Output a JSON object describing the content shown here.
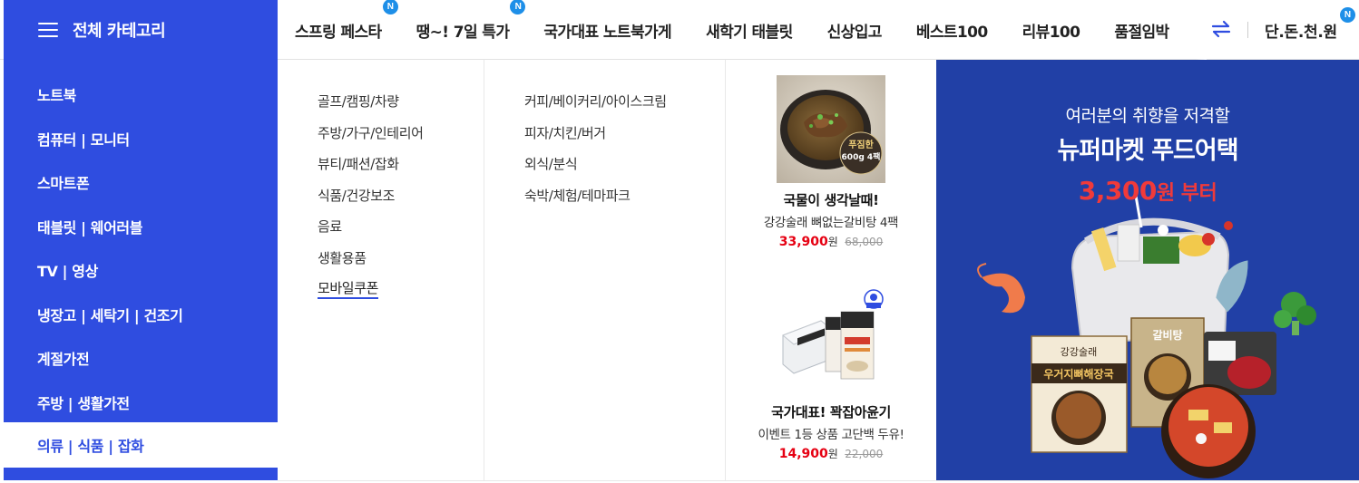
{
  "header": {
    "all_category_label": "전체 카테고리",
    "nav_items": [
      {
        "label": "스프링 페스타",
        "badge": "N"
      },
      {
        "label": "땡~! 7일 특가",
        "badge": "N"
      },
      {
        "label": "국가대표 노트북가게",
        "badge": ""
      },
      {
        "label": "새학기 태블릿",
        "badge": ""
      },
      {
        "label": "신상입고",
        "badge": ""
      },
      {
        "label": "베스트100",
        "badge": ""
      },
      {
        "label": "리뷰100",
        "badge": ""
      },
      {
        "label": "품절임박",
        "badge": ""
      }
    ],
    "right_item": {
      "label": "단.돈.천.원",
      "badge": "N"
    }
  },
  "sidebar": {
    "items": [
      {
        "label": "노트북"
      },
      {
        "label": "컴퓨터 | 모니터"
      },
      {
        "label": "스마트폰"
      },
      {
        "label": "태블릿 | 웨어러블"
      },
      {
        "label": "TV | 영상"
      },
      {
        "label": "냉장고 | 세탁기 | 건조기"
      },
      {
        "label": "계절가전"
      },
      {
        "label": "주방 | 생활가전"
      }
    ],
    "active_item": {
      "label": "의류 | 식품 | 잡화"
    }
  },
  "submenu": {
    "column1": [
      "골프/캠핑/차량",
      "주방/가구/인테리어",
      "뷰티/패션/잡화",
      "식품/건강보조",
      "음료",
      "생활용품",
      "모바일쿠폰"
    ],
    "column1_active": "모바일쿠폰",
    "column2": [
      "커피/베이커리/아이스크림",
      "피자/치킨/버거",
      "외식/분식",
      "숙박/체험/테마파크"
    ]
  },
  "products": [
    {
      "title": "국물이 생각날때!",
      "desc": "강강술래 뼈없는갈비탕 4팩",
      "price": "33,900",
      "won": "원",
      "old_price": "68,000",
      "image_tag_line1": "푸짐한",
      "image_tag_line2": "600g 4팩"
    },
    {
      "title": "국가대표! 꽉잡아윤기",
      "desc": "이벤트 1등 상품 고단백 두유!",
      "price": "14,900",
      "won": "원",
      "old_price": "22,000"
    }
  ],
  "banner": {
    "subtitle": "여러분의 취향을 저격할",
    "title": "뉴퍼마켓 푸드어택",
    "price": "3,300",
    "price_suffix": "원 부터",
    "pack_labels": {
      "brand": "강강술래",
      "main_label": "우거지뼈해장국",
      "side_label": "갈비탕"
    }
  },
  "colors": {
    "primary": "#2f4de0",
    "banner_bg": "#2140a6",
    "price_red": "#e60012",
    "badge_blue": "#1e8fe8"
  },
  "icons": {
    "menu": "hamburger-icon",
    "swap": "swap-arrows-icon",
    "new_badge": "new-badge"
  }
}
